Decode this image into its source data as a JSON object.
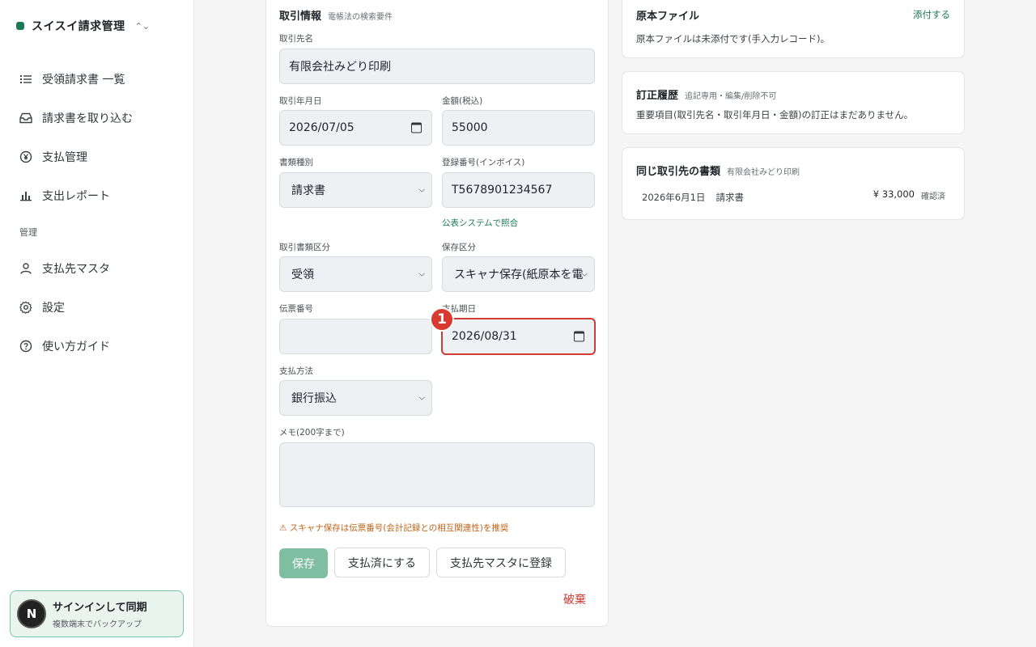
{
  "brand": {
    "name": "スイスイ請求管理",
    "accent": "#1d7a55"
  },
  "sidebar": {
    "items": [
      {
        "label": "受領請求書 一覧",
        "icon": "list-icon"
      },
      {
        "label": "請求書を取り込む",
        "icon": "inbox-icon"
      },
      {
        "label": "支払管理",
        "icon": "yen-icon"
      },
      {
        "label": "支出レポート",
        "icon": "bar-chart-icon"
      }
    ],
    "section_label": "管理",
    "admin_items": [
      {
        "label": "支払先マスタ",
        "icon": "user-icon"
      },
      {
        "label": "設定",
        "icon": "gear-icon"
      },
      {
        "label": "使い方ガイド",
        "icon": "help-icon"
      }
    ],
    "signin": {
      "avatar": "N",
      "title": "サインインして同期",
      "subtitle": "複数端末でバックアップ"
    }
  },
  "form": {
    "title": "取引情報",
    "subtitle": "電帳法の検索要件",
    "vendor": {
      "label": "取引先名",
      "value": "有限会社みどり印刷"
    },
    "date": {
      "label": "取引年月日",
      "value": "2026/07/05"
    },
    "amount": {
      "label": "金額(税込)",
      "value": "55000"
    },
    "doc_type": {
      "label": "書類種別",
      "value": "請求書"
    },
    "reg_number": {
      "label": "登録番号(インボイス)",
      "value": "T5678901234567",
      "verify_link": "公表システムで照合"
    },
    "trade_class": {
      "label": "取引書類区分",
      "value": "受領"
    },
    "storage_class": {
      "label": "保存区分",
      "value": "スキャナ保存(紙原本を電"
    },
    "slip_number": {
      "label": "伝票番号",
      "value": ""
    },
    "due_date": {
      "label": "支払期日",
      "value": "2026/08/31",
      "badge": "1"
    },
    "payment_method": {
      "label": "支払方法",
      "value": "銀行振込"
    },
    "memo": {
      "label": "メモ(200字まで)",
      "value": ""
    },
    "warning": "⚠ スキャナ保存は伝票番号(会計記録との相互関連性)を推奨",
    "buttons": {
      "save": "保存",
      "mark_paid": "支払済にする",
      "register_vendor": "支払先マスタに登録",
      "discard": "破棄"
    }
  },
  "panels": {
    "original": {
      "title": "原本ファイル",
      "attach": "添付する",
      "text": "原本ファイルは未添付です(手入力レコード)。"
    },
    "history": {
      "title": "訂正履歴",
      "subtitle": "追記専用・編集/削除不可",
      "text": "重要項目(取引先名・取引年月日・金額)の訂正はまだありません。"
    },
    "related": {
      "title": "同じ取引先の書類",
      "subtitle": "有限会社みどり印刷",
      "row": {
        "date": "2026年6月1日",
        "type": "請求書",
        "amount": "¥ 33,000",
        "status": "確認済"
      }
    }
  }
}
